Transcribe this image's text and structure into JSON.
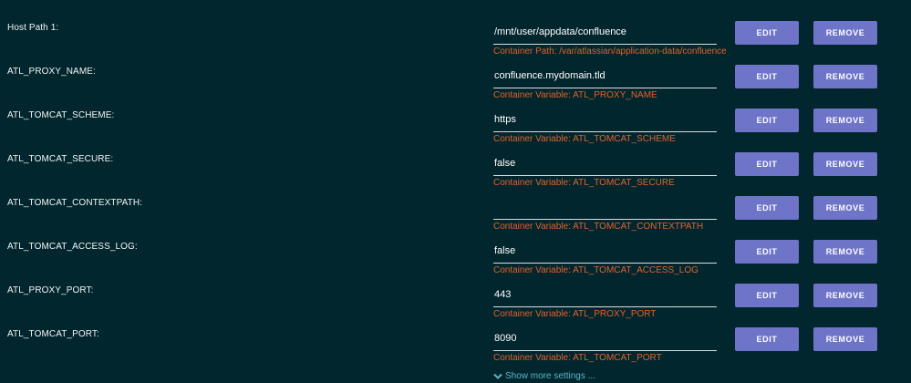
{
  "buttons": {
    "edit_label": "EDIT",
    "remove_label": "REMOVE"
  },
  "rows": [
    {
      "label": "Host Path 1:",
      "value": "/mnt/user/appdata/confluence",
      "hint": "Container Path: /var/atlassian/application-data/confluence"
    },
    {
      "label": "ATL_PROXY_NAME:",
      "value": "confluence.mydomain.tld",
      "hint": "Container Variable: ATL_PROXY_NAME"
    },
    {
      "label": "ATL_TOMCAT_SCHEME:",
      "value": "https",
      "hint": "Container Variable: ATL_TOMCAT_SCHEME"
    },
    {
      "label": "ATL_TOMCAT_SECURE:",
      "value": "false",
      "hint": "Container Variable: ATL_TOMCAT_SECURE"
    },
    {
      "label": "ATL_TOMCAT_CONTEXTPATH:",
      "value": "",
      "hint": "Container Variable: ATL_TOMCAT_CONTEXTPATH"
    },
    {
      "label": "ATL_TOMCAT_ACCESS_LOG:",
      "value": "false",
      "hint": "Container Variable: ATL_TOMCAT_ACCESS_LOG"
    },
    {
      "label": "ATL_PROXY_PORT:",
      "value": "443",
      "hint": "Container Variable: ATL_PROXY_PORT"
    },
    {
      "label": "ATL_TOMCAT_PORT:",
      "value": "8090",
      "hint": "Container Variable: ATL_TOMCAT_PORT"
    }
  ],
  "show_more_label": "Show more settings ...",
  "icons": {
    "show_more": "chevron-down-icon"
  },
  "colors": {
    "background": "#02262e",
    "button": "#6e74c8",
    "hint": "#e2622a",
    "link": "#58b7c4"
  }
}
